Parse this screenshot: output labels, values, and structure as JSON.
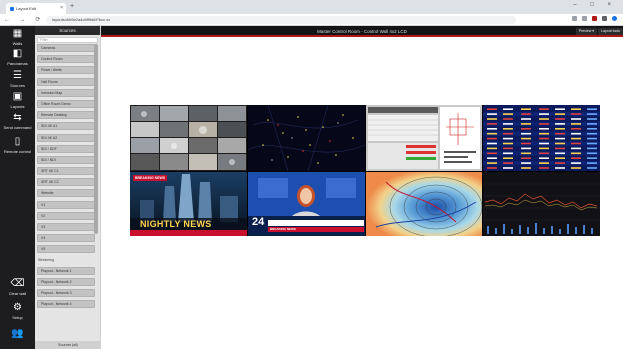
{
  "browser": {
    "tab_title": "Layout Edit",
    "url": "layouts/d/b5b2a4c6f9fd6f7bcc.xx"
  },
  "app": {
    "title": "Master Control Room - Control Wall 4x2 LCD",
    "preview_label": "Preview",
    "layout_label": "Layout tools"
  },
  "leftbar": [
    {
      "label": "Walls",
      "icon": "grid-icon"
    },
    {
      "label": "Panoramas",
      "icon": "panorama-icon"
    },
    {
      "label": "Sources",
      "icon": "list-icon"
    },
    {
      "label": "Layouts",
      "icon": "layout-icon"
    },
    {
      "label": "Send command",
      "icon": "command-icon"
    },
    {
      "label": "Remote control",
      "icon": "remote-icon"
    },
    {
      "label": "Clear wall",
      "icon": "eraser-icon"
    },
    {
      "label": "Setup",
      "icon": "gears-icon"
    },
    {
      "label": "",
      "icon": "users-icon"
    }
  ],
  "sources": {
    "header": "Sources",
    "filter_placeholder": "Filter",
    "footer": "Sources (all)",
    "items": [
      {
        "kind": "item",
        "label": "Cameras"
      },
      {
        "kind": "item",
        "label": "Control Room"
      },
      {
        "kind": "item",
        "label": "Flows / Alerts"
      },
      {
        "kind": "item",
        "label": "Hall Floors"
      },
      {
        "kind": "item",
        "label": "Intrusion Map"
      },
      {
        "kind": "item",
        "label": "Office Room Demo"
      },
      {
        "kind": "item",
        "label": "Remote Desktop"
      },
      {
        "kind": "item",
        "label": "SDI 4K A1"
      },
      {
        "kind": "item",
        "label": "SDI 4K A2"
      },
      {
        "kind": "item",
        "label": "SDI / SDF"
      },
      {
        "kind": "item",
        "label": "SDI / NDI"
      },
      {
        "kind": "item",
        "label": "SRT 4K C1"
      },
      {
        "kind": "item",
        "label": "SRT 4K C2"
      },
      {
        "kind": "item",
        "label": "Website"
      },
      {
        "kind": "item",
        "label": "V1"
      },
      {
        "kind": "item",
        "label": "V2"
      },
      {
        "kind": "item",
        "label": "V3"
      },
      {
        "kind": "item",
        "label": "V4"
      },
      {
        "kind": "item",
        "label": "V5"
      },
      {
        "kind": "group",
        "label": "Streaming"
      },
      {
        "kind": "item",
        "label": "Playout - Network 1"
      },
      {
        "kind": "item",
        "label": "Playout - Network 2"
      },
      {
        "kind": "item",
        "label": "Playout - Network 3"
      },
      {
        "kind": "item",
        "label": "Playout - Network 4"
      }
    ]
  },
  "wall": {
    "tiles": [
      {
        "name": "tile-security-cameras",
        "type": "cameras"
      },
      {
        "name": "tile-flight-radar",
        "type": "radar"
      },
      {
        "name": "tile-control-dashboard",
        "type": "dashboard"
      },
      {
        "name": "tile-market-table",
        "type": "market"
      },
      {
        "name": "tile-nightly-news",
        "type": "news",
        "text": "NIGHTLY NEWS",
        "badge": "BREAKING NEWS"
      },
      {
        "name": "tile-news-24",
        "type": "anchor",
        "text": "24",
        "ticker": "BREAKING NEWS"
      },
      {
        "name": "tile-weather-map",
        "type": "weather"
      },
      {
        "name": "tile-stock-chart",
        "type": "stock"
      }
    ]
  },
  "colors": {
    "accent": "#b01818",
    "sidebar": "#1d1d1f",
    "panel": "#e4e4e4"
  }
}
